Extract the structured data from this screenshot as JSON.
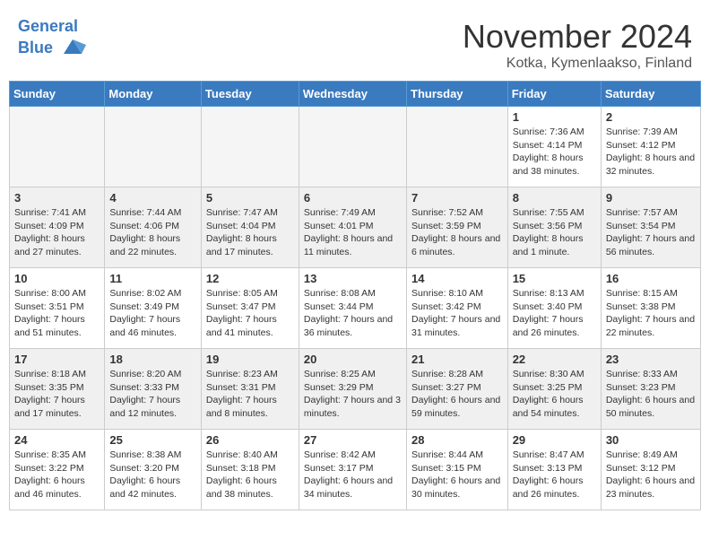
{
  "header": {
    "logo_line1": "General",
    "logo_line2": "Blue",
    "month": "November 2024",
    "location": "Kotka, Kymenlaakso, Finland"
  },
  "days_of_week": [
    "Sunday",
    "Monday",
    "Tuesday",
    "Wednesday",
    "Thursday",
    "Friday",
    "Saturday"
  ],
  "weeks": [
    [
      {
        "day": "",
        "empty": true
      },
      {
        "day": "",
        "empty": true
      },
      {
        "day": "",
        "empty": true
      },
      {
        "day": "",
        "empty": true
      },
      {
        "day": "",
        "empty": true
      },
      {
        "day": "1",
        "sunrise": "7:36 AM",
        "sunset": "4:14 PM",
        "daylight": "8 hours and 38 minutes."
      },
      {
        "day": "2",
        "sunrise": "7:39 AM",
        "sunset": "4:12 PM",
        "daylight": "8 hours and 32 minutes."
      }
    ],
    [
      {
        "day": "3",
        "sunrise": "7:41 AM",
        "sunset": "4:09 PM",
        "daylight": "8 hours and 27 minutes."
      },
      {
        "day": "4",
        "sunrise": "7:44 AM",
        "sunset": "4:06 PM",
        "daylight": "8 hours and 22 minutes."
      },
      {
        "day": "5",
        "sunrise": "7:47 AM",
        "sunset": "4:04 PM",
        "daylight": "8 hours and 17 minutes."
      },
      {
        "day": "6",
        "sunrise": "7:49 AM",
        "sunset": "4:01 PM",
        "daylight": "8 hours and 11 minutes."
      },
      {
        "day": "7",
        "sunrise": "7:52 AM",
        "sunset": "3:59 PM",
        "daylight": "8 hours and 6 minutes."
      },
      {
        "day": "8",
        "sunrise": "7:55 AM",
        "sunset": "3:56 PM",
        "daylight": "8 hours and 1 minute."
      },
      {
        "day": "9",
        "sunrise": "7:57 AM",
        "sunset": "3:54 PM",
        "daylight": "7 hours and 56 minutes."
      }
    ],
    [
      {
        "day": "10",
        "sunrise": "8:00 AM",
        "sunset": "3:51 PM",
        "daylight": "7 hours and 51 minutes."
      },
      {
        "day": "11",
        "sunrise": "8:02 AM",
        "sunset": "3:49 PM",
        "daylight": "7 hours and 46 minutes."
      },
      {
        "day": "12",
        "sunrise": "8:05 AM",
        "sunset": "3:47 PM",
        "daylight": "7 hours and 41 minutes."
      },
      {
        "day": "13",
        "sunrise": "8:08 AM",
        "sunset": "3:44 PM",
        "daylight": "7 hours and 36 minutes."
      },
      {
        "day": "14",
        "sunrise": "8:10 AM",
        "sunset": "3:42 PM",
        "daylight": "7 hours and 31 minutes."
      },
      {
        "day": "15",
        "sunrise": "8:13 AM",
        "sunset": "3:40 PM",
        "daylight": "7 hours and 26 minutes."
      },
      {
        "day": "16",
        "sunrise": "8:15 AM",
        "sunset": "3:38 PM",
        "daylight": "7 hours and 22 minutes."
      }
    ],
    [
      {
        "day": "17",
        "sunrise": "8:18 AM",
        "sunset": "3:35 PM",
        "daylight": "7 hours and 17 minutes."
      },
      {
        "day": "18",
        "sunrise": "8:20 AM",
        "sunset": "3:33 PM",
        "daylight": "7 hours and 12 minutes."
      },
      {
        "day": "19",
        "sunrise": "8:23 AM",
        "sunset": "3:31 PM",
        "daylight": "7 hours and 8 minutes."
      },
      {
        "day": "20",
        "sunrise": "8:25 AM",
        "sunset": "3:29 PM",
        "daylight": "7 hours and 3 minutes."
      },
      {
        "day": "21",
        "sunrise": "8:28 AM",
        "sunset": "3:27 PM",
        "daylight": "6 hours and 59 minutes."
      },
      {
        "day": "22",
        "sunrise": "8:30 AM",
        "sunset": "3:25 PM",
        "daylight": "6 hours and 54 minutes."
      },
      {
        "day": "23",
        "sunrise": "8:33 AM",
        "sunset": "3:23 PM",
        "daylight": "6 hours and 50 minutes."
      }
    ],
    [
      {
        "day": "24",
        "sunrise": "8:35 AM",
        "sunset": "3:22 PM",
        "daylight": "6 hours and 46 minutes."
      },
      {
        "day": "25",
        "sunrise": "8:38 AM",
        "sunset": "3:20 PM",
        "daylight": "6 hours and 42 minutes."
      },
      {
        "day": "26",
        "sunrise": "8:40 AM",
        "sunset": "3:18 PM",
        "daylight": "6 hours and 38 minutes."
      },
      {
        "day": "27",
        "sunrise": "8:42 AM",
        "sunset": "3:17 PM",
        "daylight": "6 hours and 34 minutes."
      },
      {
        "day": "28",
        "sunrise": "8:44 AM",
        "sunset": "3:15 PM",
        "daylight": "6 hours and 30 minutes."
      },
      {
        "day": "29",
        "sunrise": "8:47 AM",
        "sunset": "3:13 PM",
        "daylight": "6 hours and 26 minutes."
      },
      {
        "day": "30",
        "sunrise": "8:49 AM",
        "sunset": "3:12 PM",
        "daylight": "6 hours and 23 minutes."
      }
    ]
  ]
}
